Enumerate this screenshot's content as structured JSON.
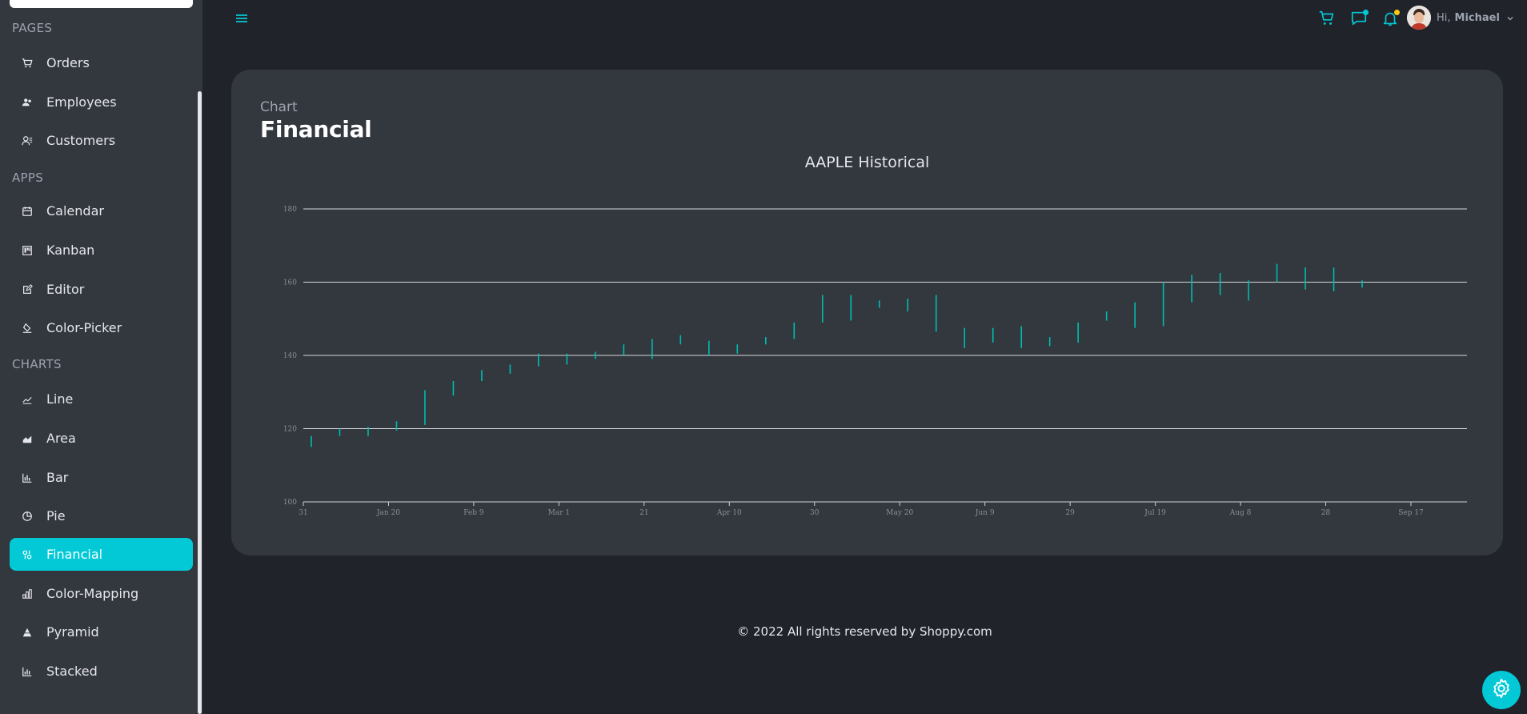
{
  "sidebar": {
    "sections": [
      {
        "title": "PAGES"
      },
      {
        "title": "APPS"
      },
      {
        "title": "CHARTS"
      }
    ],
    "items": [
      {
        "label": "Orders",
        "icon": "cart-icon"
      },
      {
        "label": "Employees",
        "icon": "employees-icon"
      },
      {
        "label": "Customers",
        "icon": "customers-icon"
      },
      {
        "label": "Calendar",
        "icon": "calendar-icon"
      },
      {
        "label": "Kanban",
        "icon": "kanban-icon"
      },
      {
        "label": "Editor",
        "icon": "edit-icon"
      },
      {
        "label": "Color-Picker",
        "icon": "paint-bucket-icon"
      },
      {
        "label": "Line",
        "icon": "line-chart-icon"
      },
      {
        "label": "Area",
        "icon": "area-chart-icon"
      },
      {
        "label": "Bar",
        "icon": "bar-chart-icon"
      },
      {
        "label": "Pie",
        "icon": "pie-chart-icon"
      },
      {
        "label": "Financial",
        "icon": "financial-icon"
      },
      {
        "label": "Color-Mapping",
        "icon": "color-mapping-icon"
      },
      {
        "label": "Pyramid",
        "icon": "pyramid-icon"
      },
      {
        "label": "Stacked",
        "icon": "stacked-chart-icon"
      }
    ],
    "active": "Financial"
  },
  "header": {
    "greeting": "Hi,",
    "user_name": "Michael",
    "icons": [
      "menu-icon",
      "cart-icon",
      "chat-icon",
      "bell-icon"
    ]
  },
  "page": {
    "kicker": "Chart",
    "title": "Financial"
  },
  "chart_data": {
    "type": "hilo",
    "title": "AAPLE Historical",
    "xlabel": "",
    "ylabel": "",
    "ylim": [
      100,
      180
    ],
    "y_ticks": [
      100,
      120,
      140,
      160,
      180
    ],
    "x_tick_labels": [
      "31",
      "Jan 20",
      "Feb 9",
      "Mar 1",
      "21",
      "Apr 10",
      "30",
      "May 20",
      "Jun 9",
      "29",
      "Jul 19",
      "Aug 8",
      "28",
      "Sep 17"
    ],
    "grid": true,
    "series_color": "#00bdae",
    "points": [
      {
        "x": 0.3,
        "low": 115,
        "high": 118
      },
      {
        "x": 1.35,
        "low": 118,
        "high": 120
      },
      {
        "x": 2.4,
        "low": 118,
        "high": 120.5
      },
      {
        "x": 3.45,
        "low": 119.5,
        "high": 122
      },
      {
        "x": 4.5,
        "low": 121,
        "high": 130.5
      },
      {
        "x": 5.55,
        "low": 129,
        "high": 133
      },
      {
        "x": 6.6,
        "low": 133,
        "high": 136
      },
      {
        "x": 7.65,
        "low": 135,
        "high": 137.5
      },
      {
        "x": 8.7,
        "low": 137,
        "high": 140.5
      },
      {
        "x": 9.75,
        "low": 137.5,
        "high": 140.5
      },
      {
        "x": 10.8,
        "low": 139,
        "high": 141
      },
      {
        "x": 11.85,
        "low": 140,
        "high": 143
      },
      {
        "x": 12.9,
        "low": 139,
        "high": 144.5
      },
      {
        "x": 13.95,
        "low": 143,
        "high": 145.5
      },
      {
        "x": 15.0,
        "low": 140,
        "high": 144
      },
      {
        "x": 16.05,
        "low": 140.5,
        "high": 143
      },
      {
        "x": 17.1,
        "low": 143,
        "high": 145
      },
      {
        "x": 18.15,
        "low": 144.5,
        "high": 149
      },
      {
        "x": 19.2,
        "low": 149,
        "high": 156.5
      },
      {
        "x": 20.25,
        "low": 149.5,
        "high": 156.5
      },
      {
        "x": 21.3,
        "low": 153,
        "high": 155
      },
      {
        "x": 22.35,
        "low": 152,
        "high": 155.5
      },
      {
        "x": 23.4,
        "low": 146.5,
        "high": 156.5
      },
      {
        "x": 24.45,
        "low": 142,
        "high": 147.5
      },
      {
        "x": 25.5,
        "low": 143.5,
        "high": 147.5
      },
      {
        "x": 26.55,
        "low": 142,
        "high": 148
      },
      {
        "x": 27.6,
        "low": 142.5,
        "high": 145
      },
      {
        "x": 28.65,
        "low": 143.5,
        "high": 149
      },
      {
        "x": 29.7,
        "low": 149.5,
        "high": 152
      },
      {
        "x": 30.75,
        "low": 147.5,
        "high": 154.5
      },
      {
        "x": 31.8,
        "low": 148,
        "high": 160
      },
      {
        "x": 32.85,
        "low": 154.5,
        "high": 162
      },
      {
        "x": 33.9,
        "low": 156.5,
        "high": 162.5
      },
      {
        "x": 34.95,
        "low": 155,
        "high": 160.5
      },
      {
        "x": 36.0,
        "low": 160,
        "high": 165
      },
      {
        "x": 37.05,
        "low": 158,
        "high": 164
      },
      {
        "x": 38.1,
        "low": 157.5,
        "high": 164
      },
      {
        "x": 39.15,
        "low": 158.5,
        "high": 160.5
      }
    ]
  },
  "footer": {
    "text": "© 2022 All rights reserved by Shoppy.com"
  },
  "settings": {
    "icon": "gear-icon"
  },
  "colors": {
    "accent": "#03c9d7",
    "background": "#20232a",
    "sidebar": "#33373e",
    "card": "#33373e"
  }
}
